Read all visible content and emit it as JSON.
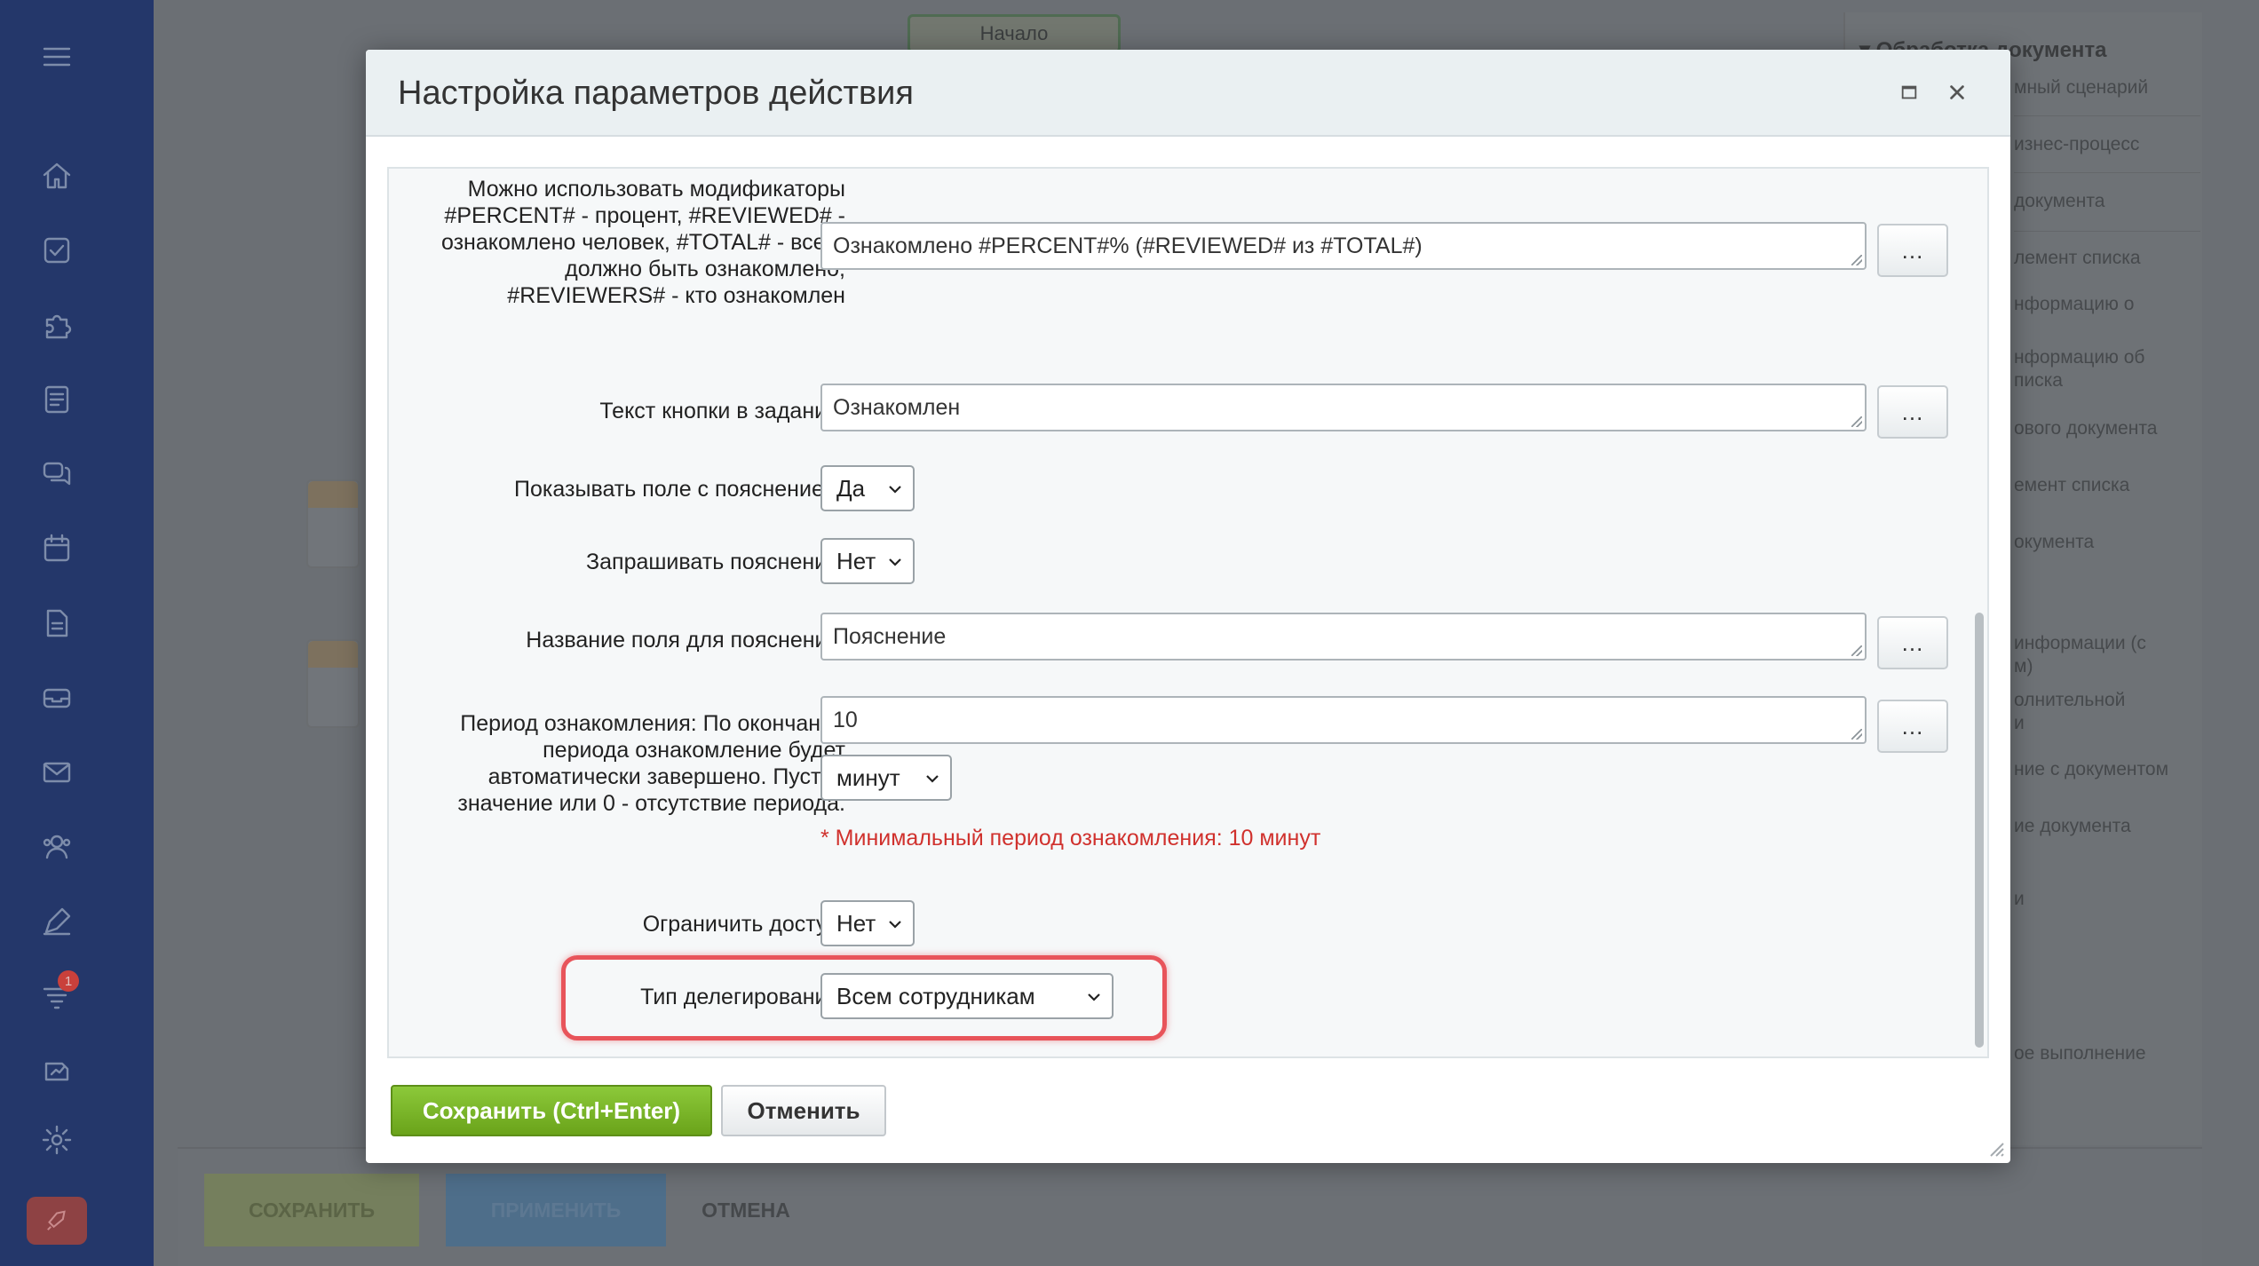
{
  "background": {
    "start_block": "Начало",
    "right_panel": {
      "title": "▾ Обработка документа",
      "items": [
        "мный сценарий",
        "изнес-процесс",
        "документа",
        "лемент списка",
        "нформацию о",
        "нформацию об\nписка",
        "ового документа",
        "емент списка",
        "окумента",
        "информации (с\nм)",
        "олнительной\nи",
        "ние с документом",
        "ие документа",
        "и",
        "ое выполнение"
      ]
    },
    "bottom_bar": {
      "save": "СОХРАНИТЬ",
      "apply": "ПРИМЕНИТЬ",
      "cancel": "ОТМЕНА"
    },
    "nav_badge": "1"
  },
  "modal": {
    "title": "Настройка параметров действия",
    "fields": {
      "status_template": {
        "label": "Можно использовать модификаторы #PERCENT# - процент, #REVIEWED# - ознакомлено человек, #TOTAL# - всего должно быть ознакомлено, #REVIEWERS# - кто ознакомлен",
        "value": "Ознакомлено #PERCENT#% (#REVIEWED# из #TOTAL#)",
        "button": "..."
      },
      "task_button_text": {
        "label": "Текст кнопки в задании:",
        "value": "Ознакомлен",
        "button": "..."
      },
      "show_comment_field": {
        "label": "Показывать поле с пояснением:",
        "value": "Да"
      },
      "require_comment": {
        "label": "Запрашивать пояснение:",
        "value": "Нет"
      },
      "comment_field_name": {
        "label": "Название поля для пояснения:",
        "value": "Пояснение",
        "button": "..."
      },
      "review_period": {
        "label": "Период ознакомления: По окончании периода ознакомление будет автоматически завершено. Пустое значение или 0 - отсутствие периода.",
        "value": "10",
        "button": "...",
        "unit": "минут",
        "hint": "* Минимальный период ознакомления: 10 минут"
      },
      "restrict_access": {
        "label": "Ограничить доступ:",
        "value": "Нет"
      },
      "delegation_type": {
        "label": "Тип делегирования:",
        "value": "Всем сотрудникам"
      }
    },
    "save_button": "Сохранить (Ctrl+Enter)",
    "cancel_button": "Отменить"
  },
  "colors": {
    "nav_bg": "#24376a",
    "save_green": "#7ab52a",
    "hint_red": "#d0312d",
    "highlight_red": "#e8545a"
  },
  "icons": [
    "menu-icon",
    "home-icon",
    "tasks-icon",
    "puzzle-icon",
    "document-list-icon",
    "chat-icon",
    "calendar-icon",
    "file-icon",
    "inbox-icon",
    "mail-icon",
    "contacts-icon",
    "pen-icon",
    "funnel-icon",
    "chart-icon",
    "gear-icon",
    "rocket-icon",
    "maximize-icon",
    "close-icon",
    "chevron-down-icon",
    "resize-grip-icon"
  ]
}
